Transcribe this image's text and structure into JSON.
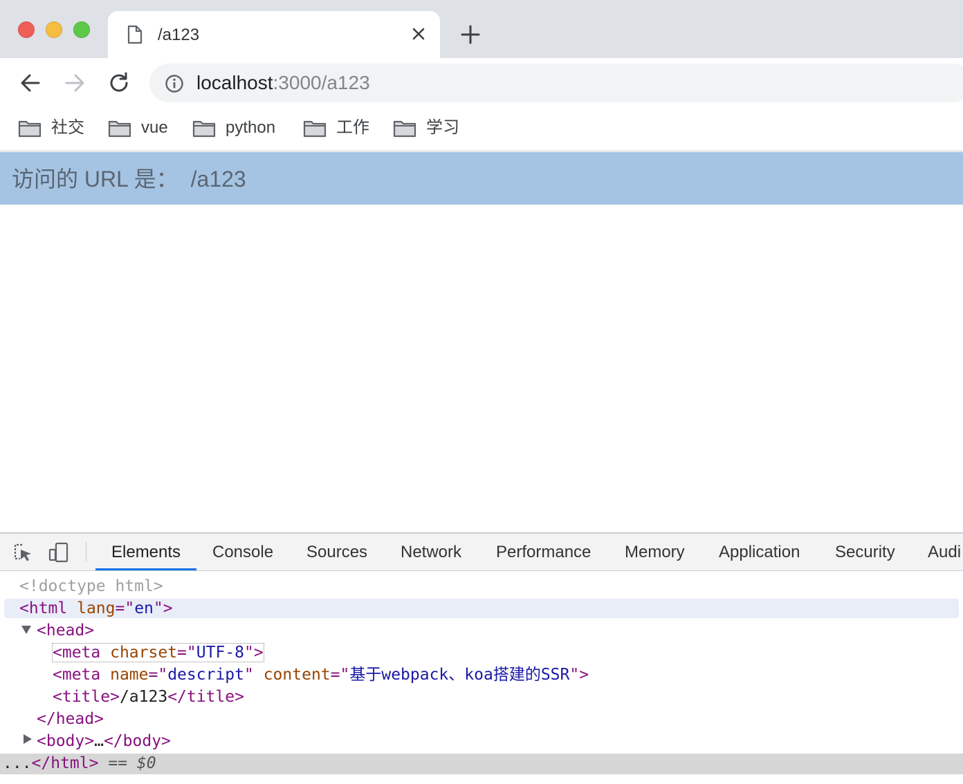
{
  "window": {
    "tab": {
      "title": "/a123"
    }
  },
  "toolbar": {
    "url_host": "localhost",
    "url_path": ":3000/a123"
  },
  "bookmarks": [
    "社交",
    "vue",
    "python",
    "工作",
    "学习"
  ],
  "page": {
    "banner_label": "访问的 URL 是：",
    "banner_path": "/a123"
  },
  "devtools": {
    "tabs": [
      "Elements",
      "Console",
      "Sources",
      "Network",
      "Performance",
      "Memory",
      "Application",
      "Security",
      "Audi"
    ],
    "active_tab": "Elements",
    "dom": {
      "doctype": "<!doctype html>",
      "html_open": {
        "tag": "<html",
        "attr": "lang",
        "value": "en",
        "close": ">"
      },
      "head_open": "<head>",
      "meta1": {
        "tag": "<meta",
        "attr": "charset",
        "value": "UTF-8",
        "close": ">"
      },
      "meta2": {
        "tag": "<meta",
        "attr1": "name",
        "val1": "descript",
        "attr2": "content",
        "val2": "基于webpack、koa搭建的SSR",
        "close": ">"
      },
      "title": {
        "open": "<title>",
        "text": "/a123",
        "close": "</title>"
      },
      "head_close": "</head>",
      "body": {
        "open": "<body>",
        "ellipsis": "…",
        "close": "</body>"
      },
      "html_close": "</html>",
      "selected_prefix": "...",
      "ref": "== $0"
    }
  },
  "colors": {
    "banner_bg": "#a5c4e3",
    "active_tab_underline": "#1a73e8",
    "tag": "#881280",
    "attr": "#994500",
    "value": "#1a1aa6"
  }
}
